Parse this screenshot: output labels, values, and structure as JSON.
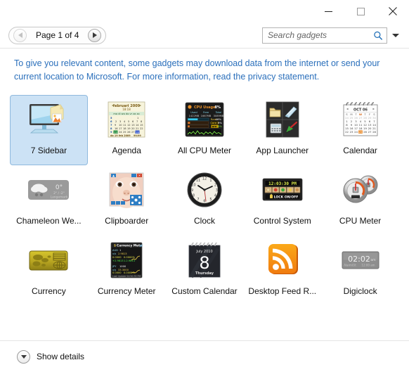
{
  "window": {
    "minimize_label": "Minimize",
    "maximize_label": "Maximize",
    "close_label": "Close"
  },
  "toolbar": {
    "prev_label": "Previous page",
    "next_label": "Next page",
    "page_label": "Page 1 of 4",
    "current_page": 1,
    "total_pages": 4
  },
  "search": {
    "placeholder": "Search gadgets",
    "value": "",
    "icon": "search-icon",
    "dropdown_icon": "chevron-down-icon"
  },
  "info": {
    "line1": "To give you relevant content, some gadgets may download data from the internet or send your",
    "line2_prefix": "current location to Microsoft. For more information, read the ",
    "link": "privacy statement",
    "line2_suffix": ".",
    "color": "#2a6fbb"
  },
  "gallery": {
    "selected_index": 0,
    "gadgets": [
      {
        "name": "7 Sidebar",
        "icon": "sidebar-monitor-icon",
        "selected": true
      },
      {
        "name": "Agenda",
        "icon": "agenda-calendar-icon",
        "selected": false,
        "detail": {
          "title": "februari 2009",
          "time": "18:18",
          "weekdays": "ma di wo do vr za zo",
          "footer1": "do 19 feb 2009",
          "footer2": "dag 50, week 8",
          "value1": "99/99",
          "value2": "99/99"
        }
      },
      {
        "name": "All CPU Meter",
        "icon": "all-cpu-meter-icon",
        "selected": false,
        "detail": {
          "title": "CPU Usage",
          "total_pct": "8%",
          "cols": [
            "Used",
            "Free",
            "Total"
          ],
          "vals": [
            "1422MB",
            "1667MB",
            "3089MB"
          ],
          "rows": [
            {
              "label": "Ram",
              "value": "46%"
            },
            {
              "label": "Core 1",
              "value": "9%"
            },
            {
              "label": "Core 2",
              "value": "8%"
            }
          ]
        }
      },
      {
        "name": "App Launcher",
        "icon": "app-launcher-icon",
        "selected": false
      },
      {
        "name": "Calendar",
        "icon": "calendar-spiral-icon",
        "selected": false,
        "detail": {
          "title": "OCT 06",
          "weekdays": [
            "S",
            "M",
            "T",
            "W",
            "T",
            "F",
            "S"
          ],
          "highlight_day": "25"
        }
      },
      {
        "name": "Chameleon We...",
        "icon": "chameleon-weather-icon",
        "selected": false,
        "detail": {
          "temp": "0°",
          "range": "2° / -2°",
          "location": "Langemark"
        }
      },
      {
        "name": "Clipboarder",
        "icon": "clipboarder-icon",
        "selected": false
      },
      {
        "name": "Clock",
        "icon": "analog-clock-icon",
        "selected": false,
        "detail": {
          "hours": 10,
          "minutes": 8,
          "seconds": 30
        }
      },
      {
        "name": "Control System",
        "icon": "control-system-icon",
        "selected": false,
        "detail": {
          "time": "12:03:30 PM",
          "lock_label": "LOCK ON/OFF"
        }
      },
      {
        "name": "CPU Meter",
        "icon": "cpu-meter-gauge-icon",
        "selected": false
      },
      {
        "name": "Currency",
        "icon": "currency-card-icon",
        "selected": false
      },
      {
        "name": "Currency Meter",
        "icon": "currency-meter-icon",
        "selected": false,
        "detail": {
          "title": "Currency Meter",
          "rows": [
            "AUD  1",
            "v/s  2.9813",
            "0.0000   0.0000%",
            "+2.9813  1.2.9813",
            "JPY  1000",
            "v/s  33.3000",
            "0.0000   0.0000%",
            "+33.300  1.33.300"
          ],
          "footer": "Last Update  04:50:35 PM"
        }
      },
      {
        "name": "Custom Calendar",
        "icon": "custom-calendar-icon",
        "selected": false,
        "detail": {
          "month": "July 2010",
          "day": "8",
          "weekday": "Thursday"
        }
      },
      {
        "name": "Desktop Feed R...",
        "icon": "rss-feed-icon",
        "selected": false
      },
      {
        "name": "Digiclock",
        "icon": "digiclock-icon",
        "selected": false,
        "detail": {
          "time": "02:02",
          "meridiem": "am",
          "alarm_label": "Alarm/Ut",
          "alarm_time": "12:00 am"
        }
      }
    ]
  },
  "footer": {
    "show_details_label": "Show details",
    "chevron_icon": "chevron-down-icon"
  }
}
